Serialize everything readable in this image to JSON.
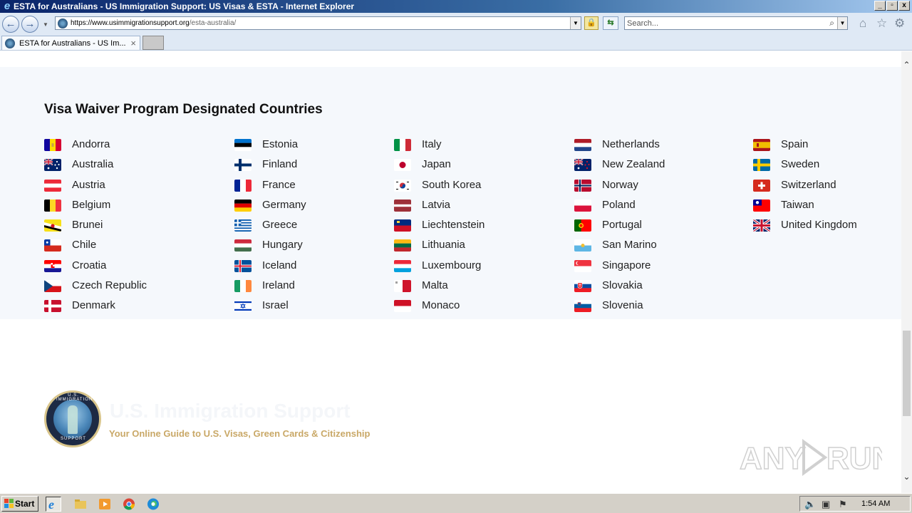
{
  "window": {
    "title": "ESTA for Australians - US Immigration Support: US Visas & ESTA - Internet Explorer",
    "controls": [
      "_",
      "▫",
      "x"
    ]
  },
  "addressbar": {
    "url_main": "https://www.usimmigrationsupport.org",
    "url_path": "/esta-australia/",
    "search_placeholder": "Search..."
  },
  "tabs": [
    {
      "label": "ESTA for Australians - US Im...",
      "active": true
    }
  ],
  "page": {
    "section_title": "Visa Waiver Program Designated Countries",
    "columns": [
      [
        {
          "name": "Andorra",
          "flag": "andorra-flag"
        },
        {
          "name": "Australia",
          "flag": "australia-flag"
        },
        {
          "name": "Austria",
          "flag": "austria-flag"
        },
        {
          "name": "Belgium",
          "flag": "belgium-flag"
        },
        {
          "name": "Brunei",
          "flag": "brunei-flag"
        },
        {
          "name": "Chile",
          "flag": "chile-flag"
        },
        {
          "name": "Croatia",
          "flag": "croatia-flag"
        },
        {
          "name": "Czech Republic",
          "flag": "czech-republic-flag"
        },
        {
          "name": "Denmark",
          "flag": "denmark-flag"
        }
      ],
      [
        {
          "name": "Estonia",
          "flag": "estonia-flag"
        },
        {
          "name": "Finland",
          "flag": "finland-flag"
        },
        {
          "name": "France",
          "flag": "france-flag"
        },
        {
          "name": "Germany",
          "flag": "germany-flag"
        },
        {
          "name": "Greece",
          "flag": "greece-flag"
        },
        {
          "name": "Hungary",
          "flag": "hungary-flag"
        },
        {
          "name": "Iceland",
          "flag": "iceland-flag"
        },
        {
          "name": "Ireland",
          "flag": "ireland-flag"
        },
        {
          "name": "Israel",
          "flag": "israel-flag"
        }
      ],
      [
        {
          "name": "Italy",
          "flag": "italy-flag"
        },
        {
          "name": "Japan",
          "flag": "japan-flag"
        },
        {
          "name": "South Korea",
          "flag": "south-korea-flag"
        },
        {
          "name": "Latvia",
          "flag": "latvia-flag"
        },
        {
          "name": "Liechtenstein",
          "flag": "liechtenstein-flag"
        },
        {
          "name": "Lithuania",
          "flag": "lithuania-flag"
        },
        {
          "name": "Luxembourg",
          "flag": "luxembourg-flag"
        },
        {
          "name": "Malta",
          "flag": "malta-flag"
        },
        {
          "name": "Monaco",
          "flag": "monaco-flag"
        }
      ],
      [
        {
          "name": "Netherlands",
          "flag": "netherlands-flag"
        },
        {
          "name": "New Zealand",
          "flag": "new-zealand-flag"
        },
        {
          "name": "Norway",
          "flag": "norway-flag"
        },
        {
          "name": "Poland",
          "flag": "poland-flag"
        },
        {
          "name": "Portugal",
          "flag": "portugal-flag"
        },
        {
          "name": "San Marino",
          "flag": "san-marino-flag"
        },
        {
          "name": "Singapore",
          "flag": "singapore-flag"
        },
        {
          "name": "Slovakia",
          "flag": "slovakia-flag"
        },
        {
          "name": "Slovenia",
          "flag": "slovenia-flag"
        }
      ],
      [
        {
          "name": "Spain",
          "flag": "spain-flag"
        },
        {
          "name": "Sweden",
          "flag": "sweden-flag"
        },
        {
          "name": "Switzerland",
          "flag": "switzerland-flag"
        },
        {
          "name": "Taiwan",
          "flag": "taiwan-flag"
        },
        {
          "name": "United Kingdom",
          "flag": "united-kingdom-flag"
        }
      ]
    ],
    "footer": {
      "brand": "U.S. Immigration Support",
      "tagline": "Your Online Guide to U.S. Visas, Green Cards & Citizenship",
      "logo_ring_top": "U.S. IMMIGRATION",
      "logo_ring_bottom": "SUPPORT"
    }
  },
  "taskbar": {
    "start_label": "Start",
    "clock": "1:54 AM",
    "quicklaunch": [
      "internet-explorer-icon",
      "file-explorer-icon",
      "media-player-icon",
      "chrome-icon",
      "edge-icon"
    ]
  },
  "watermark": "ANY RUN",
  "colors": {
    "panel_bg": "#f5f8fc",
    "tagline": "#c9a867",
    "titlebar_start": "#0a246a"
  }
}
